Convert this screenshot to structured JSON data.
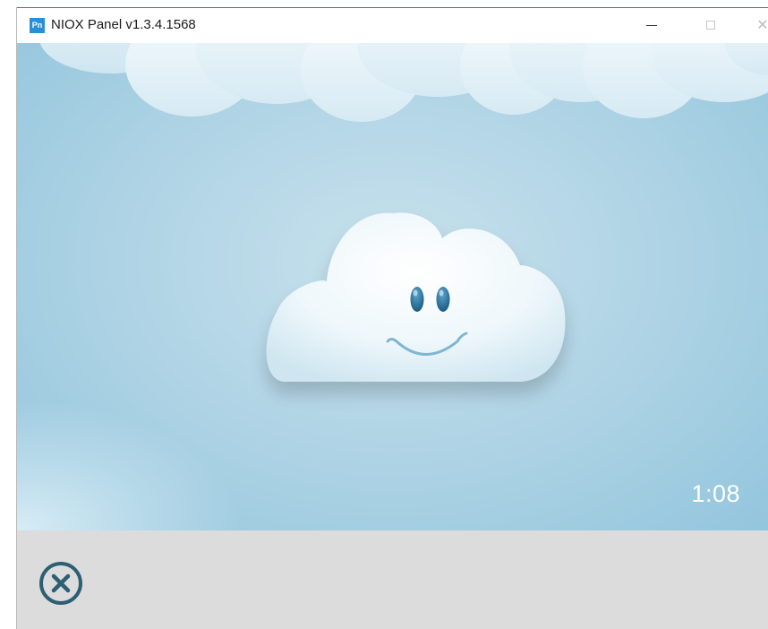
{
  "window": {
    "app_icon_text": "Pn",
    "title": "NIOX Panel v1.3.4.1568",
    "controls": {
      "minimize_icon": "minimize-icon",
      "maximize_icon": "maximize-icon",
      "close_icon": "close-icon"
    }
  },
  "scene": {
    "timer": "1:08",
    "character_icon": "smiling-cloud-icon"
  },
  "bottom_bar": {
    "cancel_icon": "cancel-circle-icon"
  },
  "colors": {
    "sky": "#b2d5e6",
    "bottom_bar": "#dcdcdc",
    "cancel": "#2d5f73",
    "eyes": "#24658c"
  }
}
